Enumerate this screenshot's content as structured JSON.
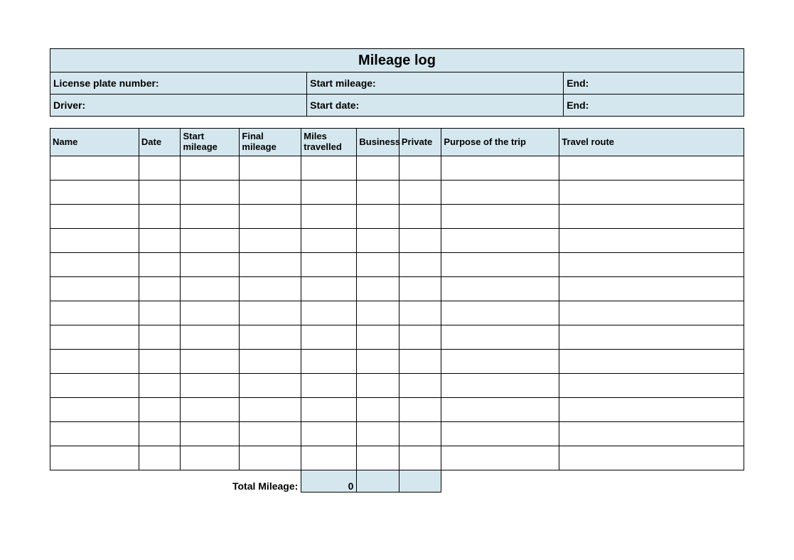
{
  "title": "Mileage log",
  "info": {
    "license_plate_label": "License plate number:",
    "start_mileage_label": "Start mileage:",
    "end1_label": "End:",
    "driver_label": "Driver:",
    "start_date_label": "Start date:",
    "end2_label": "End:"
  },
  "columns": {
    "name": "Name",
    "date": "Date",
    "start_mileage": "Start mileage",
    "final_mileage": "Final mileage",
    "miles_travelled": "Miles travelled",
    "business": "Business",
    "private": "Private",
    "purpose": "Purpose of the trip",
    "route": "Travel route"
  },
  "row_count": 13,
  "totals": {
    "label": "Total Mileage:",
    "miles": "0",
    "business": "",
    "private": ""
  }
}
